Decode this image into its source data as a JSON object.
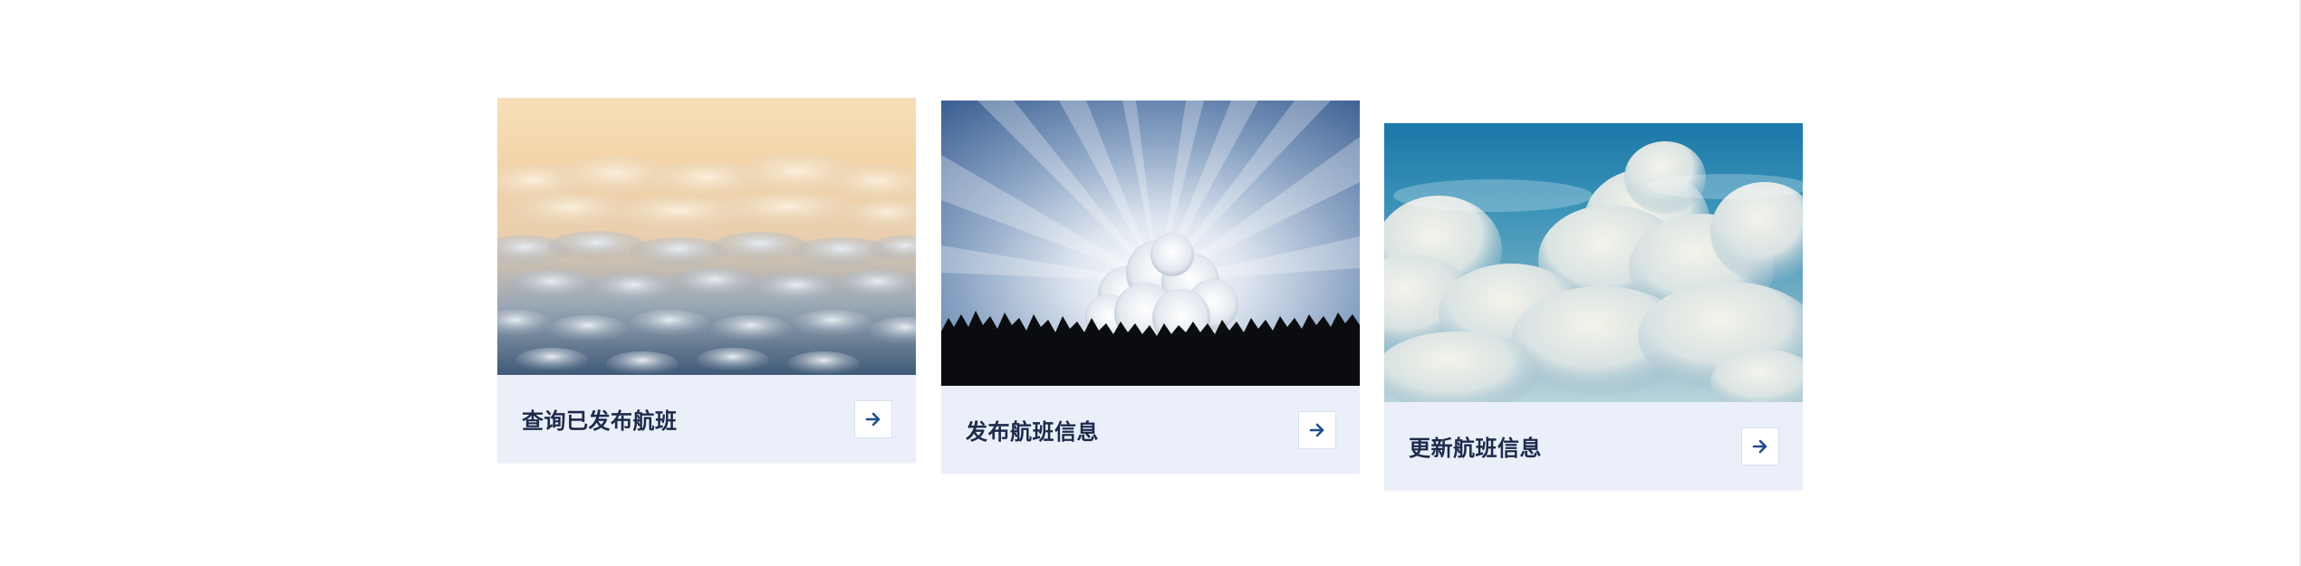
{
  "cards": [
    {
      "title": "查询已发布航班",
      "image": "sea-of-clouds-sunset",
      "icon": "arrow-right-icon"
    },
    {
      "title": "发布航班信息",
      "image": "sun-rays-behind-cloud-and-forest",
      "icon": "arrow-right-icon"
    },
    {
      "title": "更新航班信息",
      "image": "cumulus-clouds-blue-sky",
      "icon": "arrow-right-icon"
    }
  ],
  "colors": {
    "card_background": "#eaeffa",
    "title_text": "#1d2a4a",
    "arrow": "#1f4e8c",
    "page_background": "#ffffff"
  }
}
